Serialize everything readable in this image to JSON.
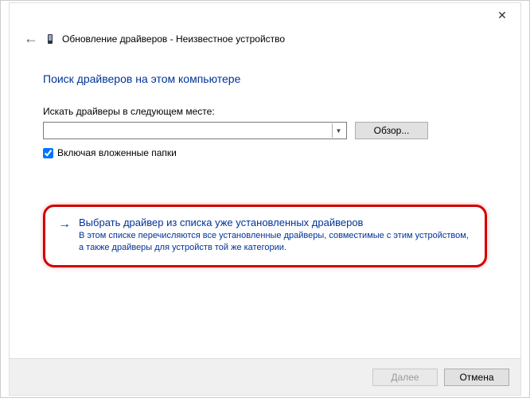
{
  "header": {
    "title": "Обновление драйверов - Неизвестное устройство"
  },
  "page": {
    "title": "Поиск драйверов на этом компьютере",
    "search_label": "Искать драйверы в следующем месте:",
    "path_value": "",
    "browse_label": "Обзор...",
    "include_subfolders_label": "Включая вложенные папки",
    "include_subfolders_checked": true
  },
  "pick": {
    "title": "Выбрать драйвер из списка уже установленных драйверов",
    "subtitle": "В этом списке перечисляются все установленные драйверы, совместимые с этим устройством, а также драйверы для устройств той же категории."
  },
  "footer": {
    "next_label": "Далее",
    "cancel_label": "Отмена"
  }
}
